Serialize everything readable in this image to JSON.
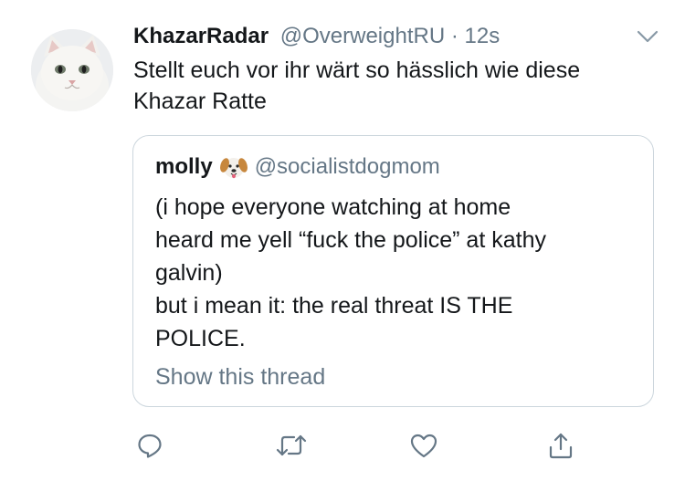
{
  "tweet": {
    "display_name": "KhazarRadar",
    "handle": "@OverweightRU",
    "separator": "·",
    "time": "12s",
    "text": "Stellt euch vor ihr wärt so hässlich wie diese Khazar Ratte"
  },
  "quoted": {
    "display_name": "molly",
    "emoji": "dog-face-icon",
    "handle": "@socialistdogmom",
    "lines": [
      "(i hope everyone watching at home",
      "heard me yell “fuck the police” at kathy",
      "galvin)",
      "but i mean it: the real threat IS THE",
      "POLICE."
    ],
    "show_thread": "Show this thread"
  },
  "actions": [
    "reply-icon",
    "retweet-icon",
    "like-icon",
    "share-icon"
  ],
  "colors": {
    "text": "#14171a",
    "secondary": "#657786",
    "border": "#ccd6dd"
  }
}
